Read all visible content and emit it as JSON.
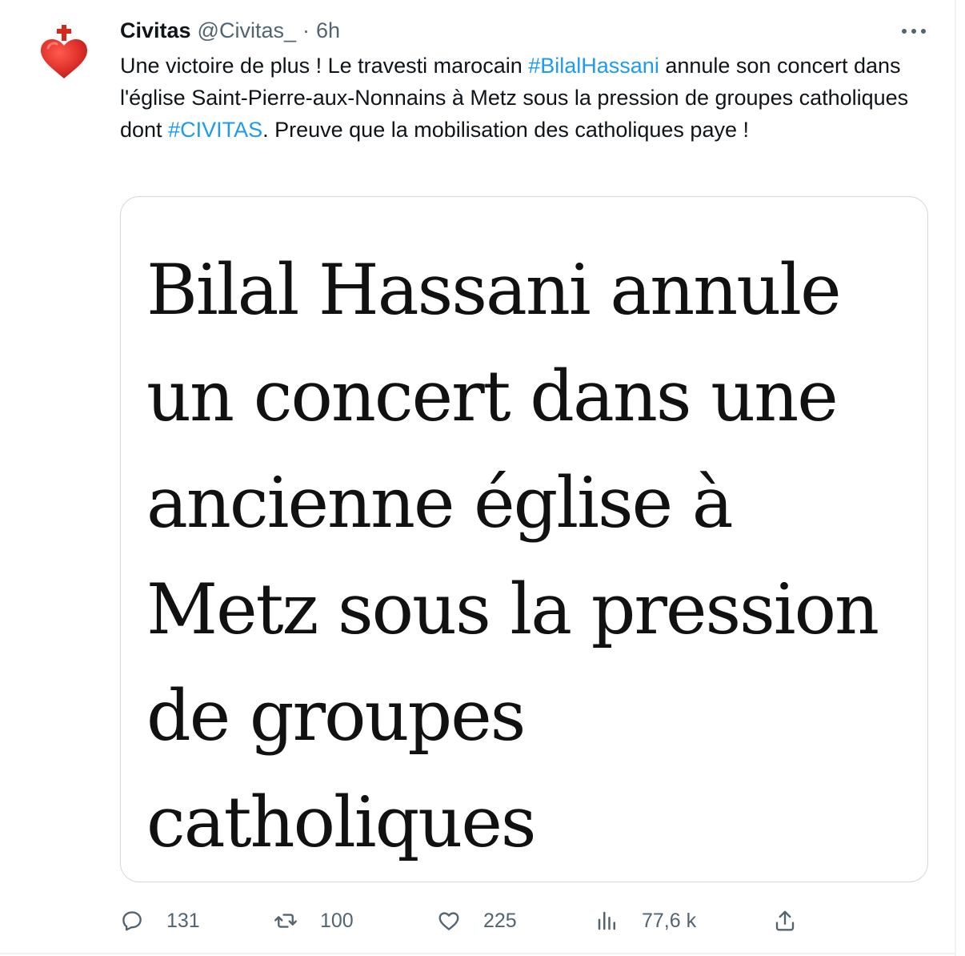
{
  "tweet": {
    "author": {
      "display_name": "Civitas",
      "handle": "@Civitas_",
      "separator": "·",
      "time": "6h"
    },
    "text": {
      "part1": "Une victoire de plus ! Le travesti marocain ",
      "hashtag1": "#BilalHassani",
      "part2": " annule son concert dans l'église Saint-Pierre-aux-Nonnains à Metz sous la pression de groupes catholiques dont ",
      "hashtag2": "#CIVITAS",
      "part3": ". Preuve que la mobilisation des catholiques paye !"
    },
    "media": {
      "headline_lines": [
        "Bilal Hassani annule",
        "un concert dans une",
        "ancienne église à",
        "Metz sous la pression",
        "de groupes",
        "catholiques"
      ]
    },
    "actions": {
      "replies": "131",
      "retweets": "100",
      "likes": "225",
      "views": "77,6 k"
    },
    "icons": {
      "more": "more-dots-icon",
      "reply": "reply-icon",
      "retweet": "retweet-icon",
      "like": "heart-icon",
      "views": "views-icon",
      "share": "share-icon"
    },
    "colors": {
      "link": "#1d9bf0",
      "secondary_text": "#536471",
      "avatar_heart": "#e0322b"
    }
  }
}
